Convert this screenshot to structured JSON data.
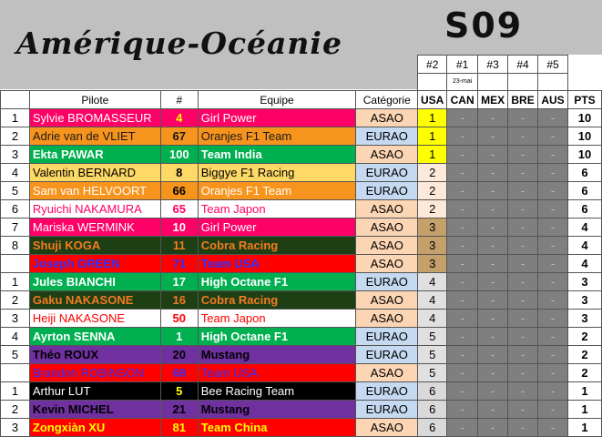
{
  "title": "Amérique-Océanie",
  "season": "S09",
  "race_numbers": [
    "#2",
    "#1",
    "#3",
    "#4",
    "#5"
  ],
  "race_dates": [
    "",
    "23-mai",
    "",
    "",
    ""
  ],
  "headers": {
    "pilot": "Pilote",
    "number": "#",
    "team": "Equipe",
    "category": "Catégorie",
    "races": [
      "USA",
      "CAN",
      "MEX",
      "BRE",
      "AUS"
    ],
    "points": "PTS"
  },
  "colors": {
    "magenta": "#ff0066",
    "orange": "#f7941d",
    "lightorange": "#ffd966",
    "darkgreen": "#1e3f14",
    "red": "#ff0000",
    "green": "#00b050",
    "purple": "#7030a0",
    "black": "#000000",
    "yellow": "#ffff00",
    "euro_blue": "#c5d9f1",
    "asia_salmon": "#fcd5b4"
  },
  "rows": [
    {
      "rank": "1",
      "pilot": "Sylvie BROMASSEUR",
      "number": "4",
      "team": "Girl Power",
      "category": "ASAO",
      "usa": "1",
      "pts": "10"
    },
    {
      "rank": "2",
      "pilot": "Adrie van de VLIET",
      "number": "67",
      "team": "Oranjes F1 Team",
      "category": "EURAO",
      "usa": "1",
      "pts": "10"
    },
    {
      "rank": "3",
      "pilot": "Ekta PAWAR",
      "number": "100",
      "team": "Team India",
      "category": "ASAO",
      "usa": "1",
      "pts": "10"
    },
    {
      "rank": "4",
      "pilot": "Valentin BERNARD",
      "number": "8",
      "team": "Biggye F1 Racing",
      "category": "EURAO",
      "usa": "2",
      "pts": "6"
    },
    {
      "rank": "5",
      "pilot": "Sam van HELVOORT",
      "number": "66",
      "team": "Oranjes F1 Team",
      "category": "EURAO",
      "usa": "2",
      "pts": "6"
    },
    {
      "rank": "6",
      "pilot": "Ryuichi NAKAMURA",
      "number": "65",
      "team": "Team Japon",
      "category": "ASAO",
      "usa": "2",
      "pts": "6"
    },
    {
      "rank": "7",
      "pilot": "Mariska WERMINK",
      "number": "10",
      "team": "Girl Power",
      "category": "ASAO",
      "usa": "3",
      "pts": "4"
    },
    {
      "rank": "8",
      "pilot": "Shuji KOGA",
      "number": "11",
      "team": "Cobra Racing",
      "category": "ASAO",
      "usa": "3",
      "pts": "4"
    },
    {
      "rank": "",
      "pilot": "Joseph GREEN",
      "number": "71",
      "team": "Team USA",
      "category": "ASAO",
      "usa": "3",
      "pts": "4"
    },
    {
      "rank": "1",
      "pilot": "Jules BIANCHI",
      "number": "17",
      "team": "High Octane F1",
      "category": "EURAO",
      "usa": "4",
      "pts": "3"
    },
    {
      "rank": "2",
      "pilot": "Gaku NAKASONE",
      "number": "16",
      "team": "Cobra Racing",
      "category": "ASAO",
      "usa": "4",
      "pts": "3"
    },
    {
      "rank": "3",
      "pilot": "Heiji NAKASONE",
      "number": "50",
      "team": "Team Japon",
      "category": "ASAO",
      "usa": "4",
      "pts": "3"
    },
    {
      "rank": "4",
      "pilot": "Ayrton SENNA",
      "number": "1",
      "team": "High Octane F1",
      "category": "EURAO",
      "usa": "5",
      "pts": "2"
    },
    {
      "rank": "5",
      "pilot": "Théo ROUX",
      "number": "20",
      "team": "Mustang",
      "category": "EURAO",
      "usa": "5",
      "pts": "2"
    },
    {
      "rank": "",
      "pilot": "Brandon ROBINSON",
      "number": "68",
      "team": "Team USA",
      "category": "ASAO",
      "usa": "5",
      "pts": "2"
    },
    {
      "rank": "1",
      "pilot": "Arthur LUT",
      "number": "5",
      "team": "Bee Racing Team",
      "category": "EURAO",
      "usa": "6",
      "pts": "1"
    },
    {
      "rank": "2",
      "pilot": "Kevin MICHEL",
      "number": "21",
      "team": "Mustang",
      "category": "EURAO",
      "usa": "6",
      "pts": "1"
    },
    {
      "rank": "3",
      "pilot": "Zongxiàn XU",
      "number": "81",
      "team": "Team China",
      "category": "ASAO",
      "usa": "6",
      "pts": "1"
    }
  ],
  "dash": "-"
}
